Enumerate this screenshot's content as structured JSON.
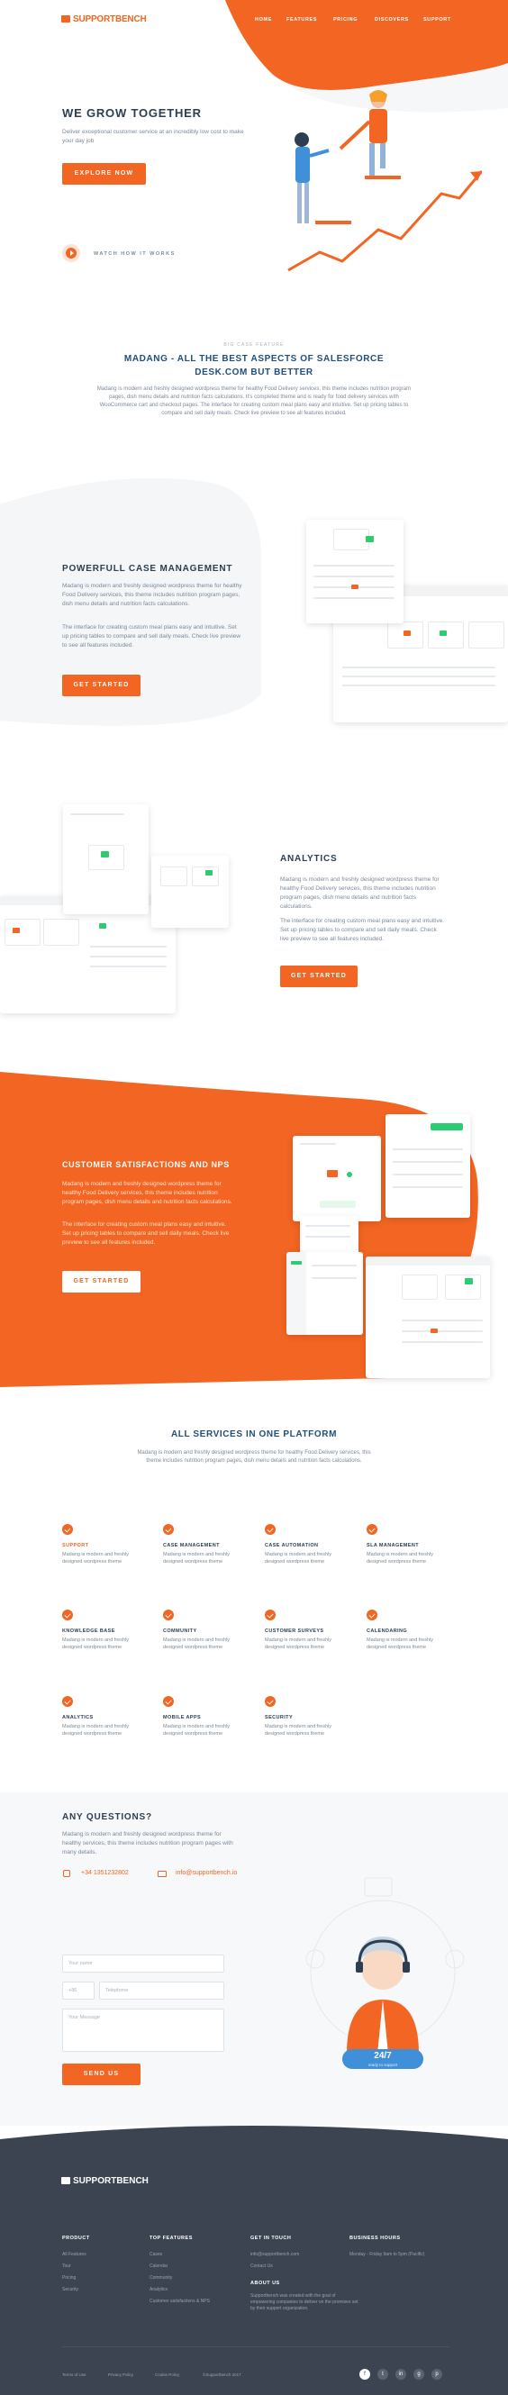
{
  "brand": {
    "name": "SUPPORTBENCH"
  },
  "nav": {
    "items": [
      "HOME",
      "FEATURES",
      "PRICING",
      "DISCOVERS",
      "SUPPORT"
    ]
  },
  "hero": {
    "title": "WE GROW TOGETHER",
    "text": "Deliver exceptional customer service at an incredibly low cost to make your day job",
    "cta": "EXPLORE NOW",
    "video": "WATCH HOW IT WORKS"
  },
  "best": {
    "eyebrow": "BIG CASE FEATURE",
    "title_line1": "MADANG - ALL THE BEST ASPECTS OF SALESFORCE",
    "title_line2": "DESK.COM BUT BETTER",
    "text": "Madang is modern and freshly designed wordpress theme for healthy Food Delivery services, this theme includes nutrition program pages, dish menu details and nutrition facts calculations. It's completed theme and is ready for food delivery services with WooCommerce cart and checkout pages. The interface for creating custom meal plans easy and intuitive. Set up pricing tables to compare and sell daily meals. Check live preview to see all features included."
  },
  "case": {
    "title": "POWERFULL CASE MANAGEMENT",
    "p1": "Madang is modern and freshly designed wordpress theme for healthy Food Delivery services, this theme includes nutrition program pages, dish menu details and nutrition facts calculations.",
    "p2": "The interface for creating custom meal plans easy and intuitive. Set up pricing tables to compare and sell daily meals. Check live preview to see all features included.",
    "cta": "GET STARTED"
  },
  "analytics": {
    "title": "ANALYTICS",
    "p1": "Madang is modern and freshly designed wordpress theme for healthy Food Delivery services, this theme includes nutrition program pages, dish menu details and nutrition facts calculations.",
    "p2": "The interface for creating custom meal plans easy and intuitive. Set up pricing tables to compare and sell daily meals. Check live preview to see all features included.",
    "cta": "GET STARTED"
  },
  "nps": {
    "title": "CUSTOMER SATISFACTIONS AND NPS",
    "p1": "Madang is modern and freshly designed wordpress theme for healthy Food Delivery services, this theme includes nutrition program pages, dish menu details and nutrition facts calculations.",
    "p2": "The interface for creating custom meal plans easy and intuitive. Set up pricing tables to compare and sell daily meals. Check live preview to see all features included.",
    "cta": "GET STARTED"
  },
  "services": {
    "title": "ALL SERVICES IN ONE PLATFORM",
    "text": "Madang is modern and freshly designed wordpress theme for healthy Food Delivery services, this theme includes nutrition program pages, dish menu details and nutrition facts calculations.",
    "items": [
      {
        "title": "SUPPORT",
        "desc": "Madang is modern and freshly designed wordpress theme"
      },
      {
        "title": "CASE MANAGEMENT",
        "desc": "Madang is modern and freshly designed wordpress theme"
      },
      {
        "title": "CASE AUTOMATION",
        "desc": "Madang is modern and freshly designed wordpress theme"
      },
      {
        "title": "SLA MANAGEMENT",
        "desc": "Madang is modern and freshly designed wordpress theme"
      },
      {
        "title": "KNOWLEDGE BASE",
        "desc": "Madang is modern and freshly designed wordpress theme"
      },
      {
        "title": "COMMUNITY",
        "desc": "Madang is modern and freshly designed wordpress theme"
      },
      {
        "title": "CUSTOMER SURVEYS",
        "desc": "Madang is modern and freshly designed wordpress theme"
      },
      {
        "title": "CALENDARING",
        "desc": "Madang is modern and freshly designed wordpress theme"
      },
      {
        "title": "ANALYTICS",
        "desc": "Madang is modern and freshly designed wordpress theme"
      },
      {
        "title": "MOBILE APPS",
        "desc": "Madang is modern and freshly designed wordpress theme"
      },
      {
        "title": "SECURITY",
        "desc": "Madang is modern and freshly designed wordpress theme"
      }
    ]
  },
  "contact": {
    "title": "ANY QUESTIONS?",
    "text": "Madang is modern and freshly designed wordpress theme for healthy services, this theme includes nutrition program pages with many details.",
    "phone": "+34 1351232802",
    "email": "info@supportbench.io",
    "name_ph": "Your name",
    "code_ph": "+86",
    "phone_ph": "Telephone",
    "message_ph": "Your Message",
    "cta": "SEND US",
    "badge_big": "24/7",
    "badge_small": "ready to support"
  },
  "footer": {
    "brand": "SUPPORTBENCH",
    "col1": {
      "title": "PRODUCT",
      "links": [
        "All Features",
        "Tour",
        "Pricing",
        "Security"
      ]
    },
    "col2": {
      "title": "TOP FEATURES",
      "links": [
        "Cases",
        "Calendar",
        "Community",
        "Analytics",
        "Customer satisfactions & NPS"
      ]
    },
    "col3": {
      "title": "GET IN TOUCH",
      "links": [
        "info@supportbench.com",
        "Contact Us"
      ],
      "about_title": "ABOUT US",
      "about": "Supportbench was created with the goal of empowering companies to deliver on the promises set by their support organization."
    },
    "col4": {
      "title": "BUSINESS HOURS",
      "text": "Monday - Friday 9am to 5pm (Pacific)"
    },
    "bottom": [
      "Terms of Use",
      "Privacy Policy",
      "Cookie Policy",
      "©Supportbench 2017"
    ],
    "social": [
      "f",
      "t",
      "in",
      "g",
      "p"
    ]
  },
  "colors": {
    "accent": "#f26522",
    "dark": "#3b4450",
    "text": "#2c3e50"
  }
}
